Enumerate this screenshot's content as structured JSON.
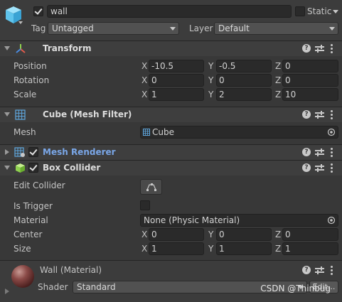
{
  "object": {
    "name": "wall",
    "active": true,
    "static_label": "Static",
    "static_checked": false,
    "tag_label": "Tag",
    "tag_value": "Untagged",
    "layer_label": "Layer",
    "layer_value": "Default"
  },
  "transform": {
    "title": "Transform",
    "rows": [
      {
        "label": "Position",
        "x": "-10.5",
        "y": "-0.5",
        "z": "0"
      },
      {
        "label": "Rotation",
        "x": "0",
        "y": "0",
        "z": "0"
      },
      {
        "label": "Scale",
        "x": "1",
        "y": "2",
        "z": "10"
      }
    ]
  },
  "axes": {
    "x": "X",
    "y": "Y",
    "z": "Z"
  },
  "mesh_filter": {
    "title": "Cube (Mesh Filter)",
    "mesh_label": "Mesh",
    "mesh_value": "Cube"
  },
  "mesh_renderer": {
    "title": "Mesh Renderer",
    "enabled": true
  },
  "box_collider": {
    "title": "Box Collider",
    "enabled": true,
    "edit_label": "Edit Collider",
    "trigger_label": "Is Trigger",
    "material_label": "Material",
    "material_value": "None (Physic Material)",
    "center": {
      "label": "Center",
      "x": "0",
      "y": "0",
      "z": "0"
    },
    "size": {
      "label": "Size",
      "x": "1",
      "y": "1",
      "z": "1"
    }
  },
  "material": {
    "title": "Wall (Material)",
    "shader_label": "Shader",
    "shader_value": "Standard",
    "edit_label": "Edit..."
  },
  "help_glyph": "?",
  "watermark": "CSDN @Thinbug",
  "colors": {
    "background": "#383838",
    "header": "#3e3e3e",
    "field": "#2a2a2a",
    "link_blue": "#7aa7e8",
    "cube_blue": "#5fc4ec",
    "collider_green": "#8fd14f"
  }
}
